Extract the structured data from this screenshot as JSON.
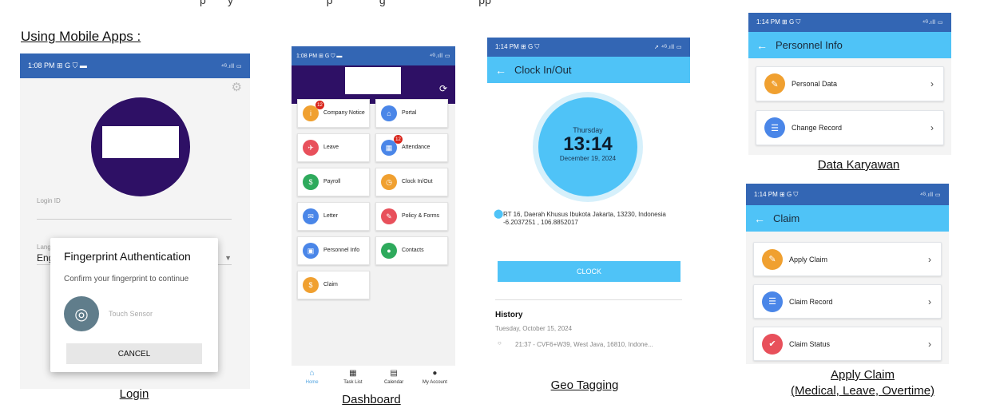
{
  "top_cut_text": "p       y                              p               g                              pp",
  "section_title": "Using Mobile Apps :",
  "colors": {
    "status_blue": "#3366b4",
    "appbar_blue": "#4fc3f7",
    "dashboard_header": "#2e1065",
    "clock_blue": "#4fc3f7"
  },
  "login": {
    "status_time": "1:08 PM",
    "status_icons": "⊞ G ⛉ ▬",
    "status_right": "⁴ᴳ.ıll ▭",
    "login_id_label": "Login ID",
    "language_label": "Lang",
    "language_value": "Eng",
    "dialog_title": "Fingerprint Authentication",
    "dialog_subtitle": "Confirm your fingerprint to continue",
    "touch_sensor": "Touch Sensor",
    "cancel_label": "CANCEL",
    "caption": "Login"
  },
  "dashboard": {
    "status_time": "1:08 PM",
    "status_icons": "⊞ G ⛉ ▬",
    "status_right": "⁴ᴳ.ıll ▭",
    "tiles": [
      {
        "label": "Company Notice",
        "color": "#f0a030",
        "icon": "info-icon",
        "glyph": "i",
        "badge": "12"
      },
      {
        "label": "Portal",
        "color": "#4a86e8",
        "icon": "home-icon",
        "glyph": "⌂",
        "badge": ""
      },
      {
        "label": "Leave",
        "color": "#e8505b",
        "icon": "plane-icon",
        "glyph": "✈",
        "badge": ""
      },
      {
        "label": "Attendance",
        "color": "#4a86e8",
        "icon": "calendar-icon",
        "glyph": "▦",
        "badge": "12"
      },
      {
        "label": "Payroll",
        "color": "#2eaa5c",
        "icon": "money-icon",
        "glyph": "$",
        "badge": ""
      },
      {
        "label": "Clock In/Out",
        "color": "#f0a030",
        "icon": "clock-icon",
        "glyph": "◷",
        "badge": ""
      },
      {
        "label": "Letter",
        "color": "#4a86e8",
        "icon": "letter-icon",
        "glyph": "✉",
        "badge": ""
      },
      {
        "label": "Policy & Forms",
        "color": "#e8505b",
        "icon": "policy-icon",
        "glyph": "✎",
        "badge": ""
      },
      {
        "label": "Personnel Info",
        "color": "#4a86e8",
        "icon": "id-card-icon",
        "glyph": "▣",
        "badge": ""
      },
      {
        "label": "Contacts",
        "color": "#2eaa5c",
        "icon": "person-icon",
        "glyph": "●",
        "badge": ""
      },
      {
        "label": "Claim",
        "color": "#f0a030",
        "icon": "claim-icon",
        "glyph": "$",
        "badge": ""
      }
    ],
    "tabs": [
      {
        "label": "Home",
        "icon": "home-icon",
        "glyph": "⌂",
        "active": true
      },
      {
        "label": "Task List",
        "icon": "task-list-icon",
        "glyph": "▦",
        "active": false
      },
      {
        "label": "Calendar",
        "icon": "calendar-icon",
        "glyph": "▤",
        "active": false
      },
      {
        "label": "My Account",
        "icon": "account-icon",
        "glyph": "●",
        "active": false
      }
    ],
    "caption": "Dashboard"
  },
  "geo": {
    "status_time": "1:14 PM",
    "status_icons": "⊞ G ⛉",
    "status_right": "➚ ⁴ᴳ.ıll ▭",
    "title": "Clock In/Out",
    "day": "Thursday",
    "time": "13:14",
    "date": "December 19, 2024",
    "address": "RT 16, Daerah Khusus Ibukota Jakarta, 13230, Indonesia",
    "coords": "-6.2037251 , 106.8852017",
    "clock_button": "CLOCK",
    "history_title": "History",
    "history_date": "Tuesday, October 15, 2024",
    "history_entry": "21:37 - CVF6+W39, West Java, 16810, Indone...",
    "caption": "Geo Tagging"
  },
  "personnel": {
    "status_time": "1:14 PM",
    "status_icons": "⊞ G ⛉",
    "status_right": "⁴ᴳ.ıll ▭",
    "title": "Personnel Info",
    "items": [
      {
        "label": "Personal Data",
        "color": "#f0a030",
        "icon": "edit-icon",
        "glyph": "✎"
      },
      {
        "label": "Change Record",
        "color": "#4a86e8",
        "icon": "list-icon",
        "glyph": "☰"
      }
    ],
    "caption": "Data Karyawan"
  },
  "claim": {
    "status_time": "1:14 PM",
    "status_icons": "⊞ G ⛉",
    "status_right": "⁴ᴳ.ıll ▭",
    "title": "Claim",
    "items": [
      {
        "label": "Apply Claim",
        "color": "#f0a030",
        "icon": "edit-icon",
        "glyph": "✎"
      },
      {
        "label": "Claim Record",
        "color": "#4a86e8",
        "icon": "list-icon",
        "glyph": "☰"
      },
      {
        "label": "Claim Status",
        "color": "#e8505b",
        "icon": "check-icon",
        "glyph": "✔"
      }
    ],
    "caption_line1": "Apply Claim",
    "caption_line2": "(Medical, Leave, Overtime)"
  }
}
